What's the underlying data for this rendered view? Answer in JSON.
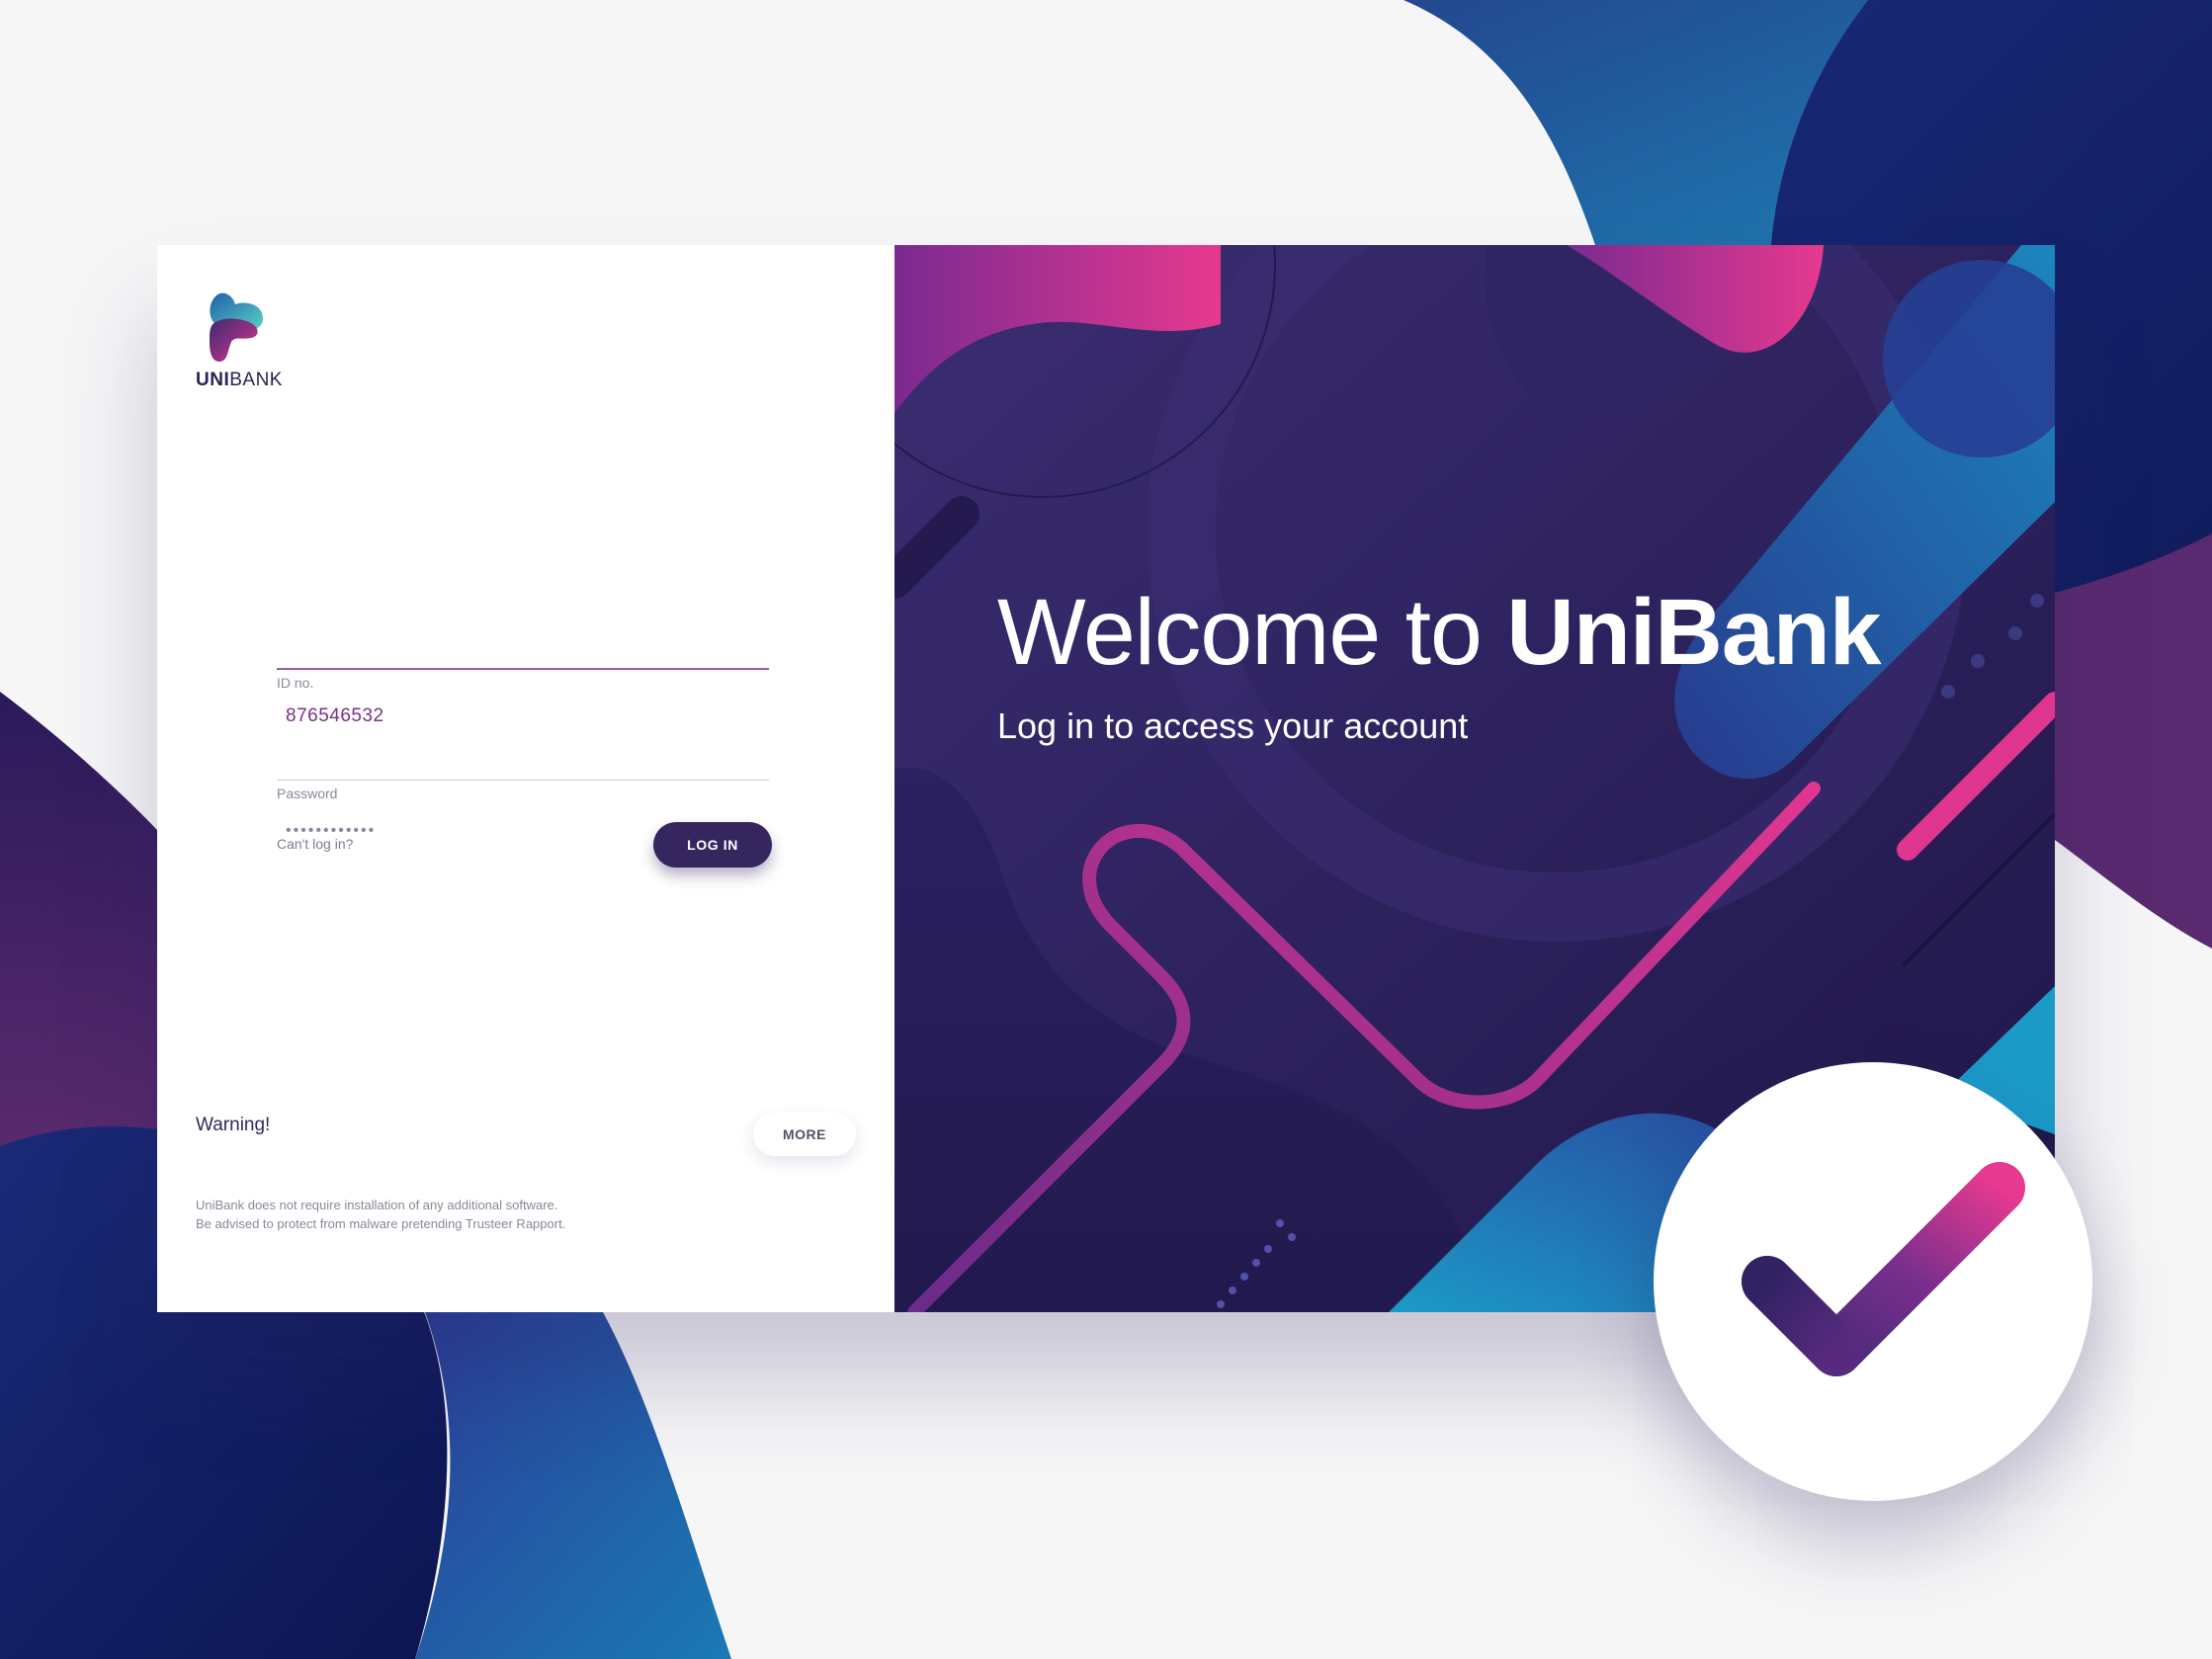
{
  "brand": {
    "name_bold": "UNI",
    "name_light": "BANK",
    "colors": {
      "deep_purple": "#35265f",
      "magenta": "#e0368f",
      "blue": "#1f6fb0",
      "panel": "#2a1e56"
    }
  },
  "form": {
    "id_label": "ID no.",
    "id_value": "876546532",
    "password_label": "Password",
    "password_value": "••••••••••••",
    "cant_login": "Can't log in?",
    "login_button": "LOG IN"
  },
  "warning": {
    "title": "Warning!",
    "line1": "UniBank does not require installation of any additional software.",
    "line2": "Be advised to protect from malware pretending Trusteer Rapport.",
    "more_button": "MORE"
  },
  "hero": {
    "title_light": "Welcome to ",
    "title_bold": "UniBank",
    "subtitle": "Log in to access your account"
  },
  "icons": {
    "logo": "unibank-logo-icon",
    "badge": "checkmark-icon"
  }
}
